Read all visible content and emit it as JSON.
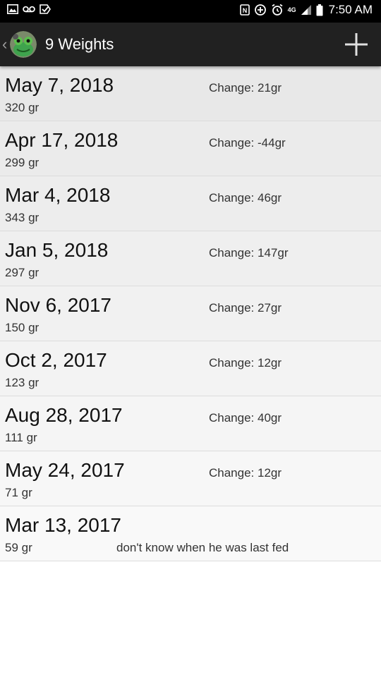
{
  "status_bar": {
    "time": "7:50 AM",
    "lte_label": "4G",
    "left_icons": [
      "gallery-icon",
      "voicemail-icon",
      "check-icon"
    ],
    "right_icons": [
      "nfc-icon",
      "data-saver-icon",
      "alarm-icon",
      "lte-icon",
      "signal-icon",
      "battery-icon"
    ]
  },
  "app_bar": {
    "title": "9 Weights",
    "back_icon": "chevron-left-icon",
    "avatar_icon": "frog-avatar-icon",
    "add_icon": "plus-icon"
  },
  "weights": [
    {
      "date": "May 7, 2018",
      "weight": "320 gr",
      "change": "Change: 21gr"
    },
    {
      "date": "Apr 17, 2018",
      "weight": "299 gr",
      "change": "Change: -44gr"
    },
    {
      "date": "Mar 4, 2018",
      "weight": "343 gr",
      "change": "Change: 46gr"
    },
    {
      "date": "Jan 5, 2018",
      "weight": "297 gr",
      "change": "Change: 147gr"
    },
    {
      "date": "Nov 6, 2017",
      "weight": "150 gr",
      "change": "Change: 27gr"
    },
    {
      "date": "Oct 2, 2017",
      "weight": "123 gr",
      "change": "Change: 12gr"
    },
    {
      "date": "Aug 28, 2017",
      "weight": "111 gr",
      "change": "Change: 40gr"
    },
    {
      "date": "May 24, 2017",
      "weight": "71 gr",
      "change": "Change: 12gr"
    },
    {
      "date": "Mar 13, 2017",
      "weight": "59 gr",
      "note": "don't know when he was last fed"
    }
  ],
  "colors": {
    "app_bar": "#212121",
    "status_bar": "#000000",
    "list_background": "#ffffff"
  }
}
